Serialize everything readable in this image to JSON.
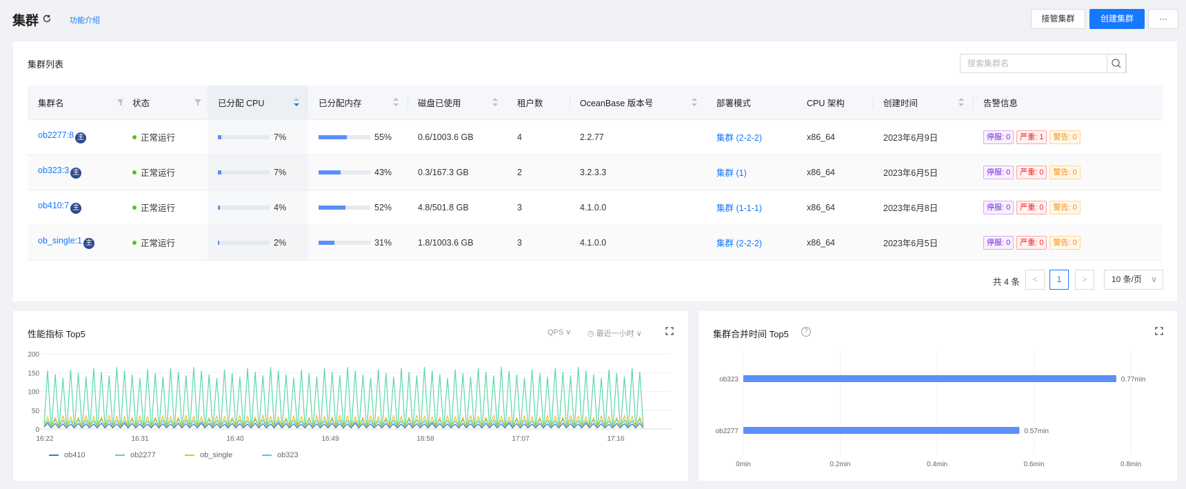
{
  "header": {
    "title": "集群",
    "intro_link": "功能介绍",
    "btn_takeover": "接管集群",
    "btn_create": "创建集群",
    "btn_more": "···"
  },
  "list": {
    "title": "集群列表",
    "search_placeholder": "搜索集群名",
    "columns": [
      "集群名",
      "状态",
      "已分配 CPU",
      "已分配内存",
      "磁盘已使用",
      "租户数",
      "OceanBase 版本号",
      "部署模式",
      "CPU 架构",
      "创建时间",
      "告警信息"
    ],
    "rows": [
      {
        "name": "ob2277:8",
        "main": "主",
        "status": "正常运行",
        "cpu": 7,
        "cpu_label": "7%",
        "mem": 55,
        "mem_label": "55%",
        "disk": "0.6/1003.6 GB",
        "tenants": "4",
        "version": "2.2.77",
        "mode": "集群 (2-2-2)",
        "arch": "x86_64",
        "created": "2023年6月9日",
        "alerts": [
          "停服: 0",
          "严重: 1",
          "警告: 0"
        ]
      },
      {
        "name": "ob323:3",
        "main": "主",
        "status": "正常运行",
        "cpu": 7,
        "cpu_label": "7%",
        "mem": 43,
        "mem_label": "43%",
        "disk": "0.3/167.3 GB",
        "tenants": "2",
        "version": "3.2.3.3",
        "mode": "集群 (1)",
        "arch": "x86_64",
        "created": "2023年6月5日",
        "alerts": [
          "停服: 0",
          "严重: 0",
          "警告: 0"
        ]
      },
      {
        "name": "ob410:7",
        "main": "主",
        "status": "正常运行",
        "cpu": 4,
        "cpu_label": "4%",
        "mem": 52,
        "mem_label": "52%",
        "disk": "4.8/501.8 GB",
        "tenants": "3",
        "version": "4.1.0.0",
        "mode": "集群 (1-1-1)",
        "arch": "x86_64",
        "created": "2023年6月8日",
        "alerts": [
          "停服: 0",
          "严重: 0",
          "警告: 0"
        ]
      },
      {
        "name": "ob_single:1",
        "main": "主",
        "status": "正常运行",
        "cpu": 2,
        "cpu_label": "2%",
        "mem": 31,
        "mem_label": "31%",
        "disk": "1.8/1003.6 GB",
        "tenants": "3",
        "version": "4.1.0.0",
        "mode": "集群 (2-2-2)",
        "arch": "x86_64",
        "created": "2023年6月5日",
        "alerts": [
          "停服: 0",
          "严重: 0",
          "警告: 0"
        ]
      }
    ],
    "pager": {
      "total": "共 4 条",
      "prev": "<",
      "page": "1",
      "next": ">",
      "size": "10 条/页"
    }
  },
  "perf": {
    "title": "性能指标 Top5",
    "metric": "QPS",
    "range": "最近一小时"
  },
  "merge": {
    "title": "集群合并时间 Top5"
  },
  "colors": {
    "primary": "#1677ff",
    "ob410": "#2f7cc4",
    "ob2277": "#5ad8a6",
    "ob_single": "#f6bd16",
    "ob323": "#4cc9e6",
    "bar": "#5b8ff9"
  },
  "chart_data": [
    {
      "type": "line",
      "title": "性能指标 Top5",
      "x_ticks": [
        "16:22",
        "16:31",
        "16:40",
        "16:49",
        "16:58",
        "17:07",
        "17:16"
      ],
      "y_ticks": [
        "0",
        "50",
        "100",
        "150",
        "200"
      ],
      "ylim": [
        0,
        200
      ],
      "series": [
        {
          "name": "ob410",
          "base": 5,
          "peak": 15
        },
        {
          "name": "ob2277",
          "base": 15,
          "peak": 160
        },
        {
          "name": "ob_single",
          "base": 10,
          "peak": 35
        },
        {
          "name": "ob323",
          "base": 8,
          "peak": 25
        }
      ],
      "peaks": 78,
      "legend": "bottom-left"
    },
    {
      "type": "bar",
      "title": "集群合并时间 Top5",
      "orientation": "horizontal",
      "categories": [
        "ob323",
        "ob2277"
      ],
      "values": [
        0.77,
        0.57
      ],
      "value_labels": [
        "0.77min",
        "0.57min"
      ],
      "x_ticks": [
        "0min",
        "0.2min",
        "0.4min",
        "0.6min",
        "0.8min"
      ],
      "xlim": [
        0,
        0.8
      ]
    }
  ]
}
